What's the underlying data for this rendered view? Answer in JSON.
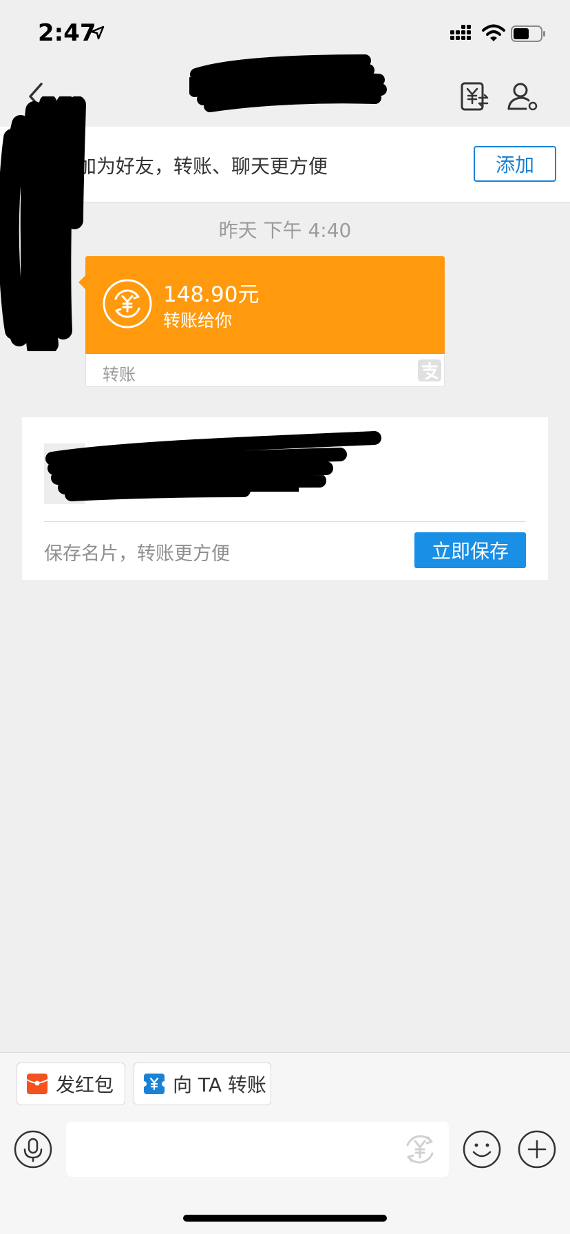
{
  "status_bar": {
    "time": "2:47"
  },
  "friend_banner": {
    "text": "加为好友，转账、聊天更方便",
    "add_label": "添加"
  },
  "chat": {
    "timestamp": "昨天 下午 4:40",
    "transfer": {
      "amount": "148.90元",
      "subtitle": "转账给你",
      "label": "转账"
    }
  },
  "save_card": {
    "text": "保存名片，转账更方便",
    "button_label": "立即保存"
  },
  "bottom_bar": {
    "red_packet_label": "发红包",
    "transfer_label": "向 TA 转账"
  },
  "colors": {
    "accent_blue": "#1a8fe6",
    "transfer_orange": "#ff9a0e",
    "red_packet": "#f4511e"
  }
}
